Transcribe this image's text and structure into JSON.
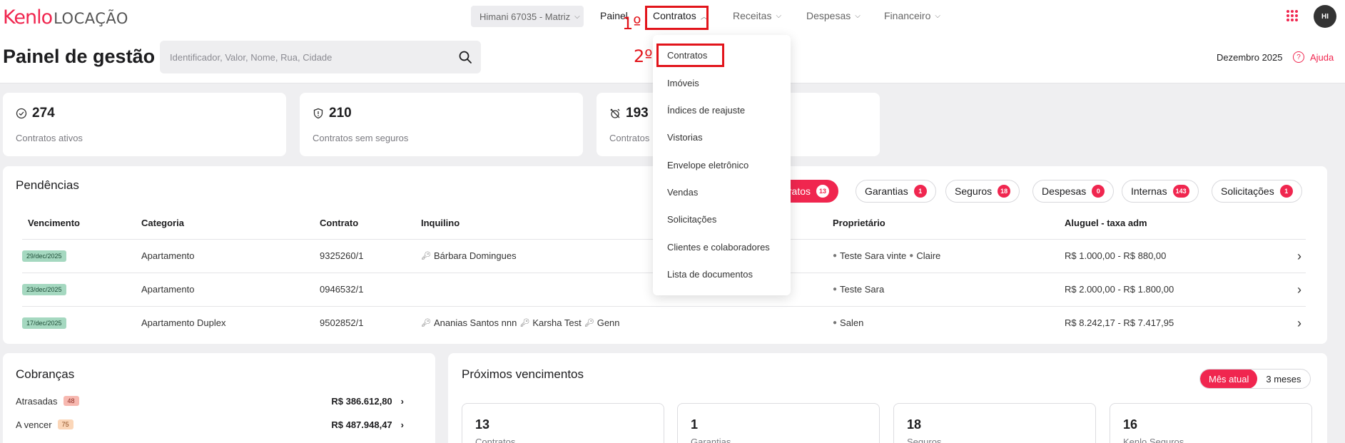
{
  "brand": {
    "logo_primary": "Kenlo",
    "logo_secondary": "LOCAÇÃO",
    "accent": "#f0264f"
  },
  "header": {
    "branch": "Himani 67035 - Matriz",
    "nav": [
      "Painel",
      "Contratos",
      "Receitas",
      "Despesas",
      "Financeiro"
    ],
    "avatar": "HI",
    "apps_icon": "grid-dots-icon"
  },
  "page": {
    "title": "Painel de gestão",
    "search_placeholder": "Identificador, Valor, Nome, Rua, Cidade",
    "month": "Dezembro 2025",
    "help": "Ajuda"
  },
  "stats": [
    {
      "value": "274",
      "label": "Contratos ativos",
      "icon": "check-circle-icon"
    },
    {
      "value": "210",
      "label": "Contratos sem seguros",
      "icon": "shield-icon"
    },
    {
      "value": "193",
      "label": "Contratos",
      "icon": "alarm-off-icon"
    }
  ],
  "pendencias": {
    "title": "Pendências",
    "chips": [
      {
        "label": "tratos",
        "badge": "13",
        "active": true
      },
      {
        "label": "Garantias",
        "badge": "1"
      },
      {
        "label": "Seguros",
        "badge": "18"
      },
      {
        "label": "Despesas",
        "badge": "0"
      },
      {
        "label": "Internas",
        "badge": "143"
      },
      {
        "label": "Solicitações",
        "badge": "1"
      }
    ],
    "columns": [
      "Vencimento",
      "Categoria",
      "Contrato",
      "Inquilino",
      "Proprietário",
      "Aluguel - taxa adm"
    ],
    "rows": [
      {
        "date": "29/dec/2025",
        "categoria": "Apartamento",
        "contrato": "9325260/1",
        "inquilinos": [
          "Bárbara Domingues"
        ],
        "proprietarios": [
          "Teste Sara vinte",
          "Claire"
        ],
        "aluguel": "R$ 1.000,00 - R$ 880,00"
      },
      {
        "date": "23/dec/2025",
        "categoria": "Apartamento",
        "contrato": "0946532/1",
        "inquilinos": [],
        "proprietarios": [
          "Teste Sara"
        ],
        "aluguel": "R$ 2.000,00 - R$ 1.800,00"
      },
      {
        "date": "17/dec/2025",
        "categoria": "Apartamento Duplex",
        "contrato": "9502852/1",
        "inquilinos": [
          "Ananias Santos nnn",
          "Karsha Test",
          "Genn"
        ],
        "proprietarios": [
          "Salen"
        ],
        "aluguel": "R$ 8.242,17 - R$ 7.417,95"
      }
    ]
  },
  "cobrancas": {
    "title": "Cobranças",
    "rows": [
      {
        "label": "Atrasadas",
        "badge": "48",
        "badge_bg": "#f7b8b0",
        "badge_fg": "#8a2a1f",
        "value": "R$ 386.612,80"
      },
      {
        "label": "A vencer",
        "badge": "75",
        "badge_bg": "#fbd6b8",
        "badge_fg": "#8a4a1f",
        "value": "R$ 487.948,47"
      }
    ]
  },
  "proximos": {
    "title": "Próximos vencimentos",
    "toggle": [
      "Mês atual",
      "3 meses"
    ],
    "cards": [
      {
        "value": "13",
        "label": "Contratos"
      },
      {
        "value": "1",
        "label": "Garantias"
      },
      {
        "value": "18",
        "label": "Seguros"
      },
      {
        "value": "16",
        "label": "Kenlo Seguros"
      }
    ]
  },
  "dropdown": {
    "items": [
      "Contratos",
      "Imóveis",
      "Índices de reajuste",
      "Vistorias",
      "Envelope eletrônico",
      "Vendas",
      "Solicitações",
      "Clientes e colaboradores",
      "Lista de documentos"
    ]
  },
  "annotations": {
    "step1": "1º",
    "step2": "2º",
    "color": "#e2141b"
  }
}
